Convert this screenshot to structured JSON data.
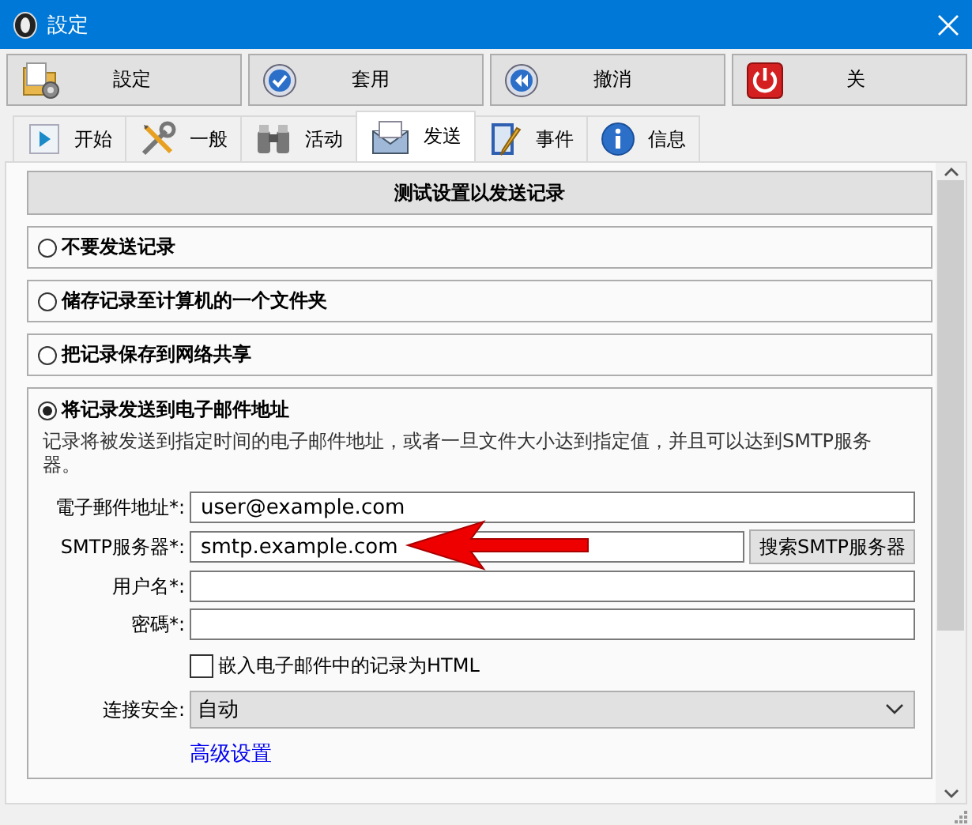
{
  "window": {
    "title": "設定"
  },
  "toolbar": [
    {
      "label": "設定",
      "kind": "settings"
    },
    {
      "label": "套用",
      "kind": "apply"
    },
    {
      "label": "撤消",
      "kind": "undo"
    },
    {
      "label": "关",
      "kind": "power"
    }
  ],
  "tabs": [
    {
      "label": "开始",
      "kind": "start",
      "selected": false
    },
    {
      "label": "一般",
      "kind": "tools",
      "selected": false
    },
    {
      "label": "活动",
      "kind": "activity",
      "selected": false
    },
    {
      "label": "发送",
      "kind": "mail",
      "selected": true
    },
    {
      "label": "事件",
      "kind": "event",
      "selected": false
    },
    {
      "label": "信息",
      "kind": "info",
      "selected": false
    }
  ],
  "header": "测试设置以发送记录",
  "options": [
    {
      "label": "不要发送记录",
      "selected": false
    },
    {
      "label": "储存记录至计算机的一个文件夹",
      "selected": false
    },
    {
      "label": "把记录保存到网络共享",
      "selected": false
    },
    {
      "label": "将记录发送到电子邮件地址",
      "selected": true,
      "details": {
        "description": "记录将被发送到指定时间的电子邮件地址，或者一旦文件大小达到指定值，并且可以达到SMTP服务器。",
        "fields": [
          {
            "kind": "text",
            "label": "電子郵件地址*:",
            "value": "user@example.com"
          },
          {
            "kind": "text_button",
            "label": "SMTP服务器*:",
            "value": "smtp.example.com",
            "button": "搜索SMTP服务器"
          },
          {
            "kind": "text",
            "label": "用户名*:"
          },
          {
            "kind": "text",
            "label": "密碼*:"
          },
          {
            "kind": "checkbox",
            "label": "嵌入电子邮件中的记录为HTML",
            "checked": false
          },
          {
            "kind": "select",
            "label": "连接安全:",
            "value": "自动"
          },
          {
            "kind": "link",
            "label": "高级设置"
          }
        ]
      }
    }
  ]
}
